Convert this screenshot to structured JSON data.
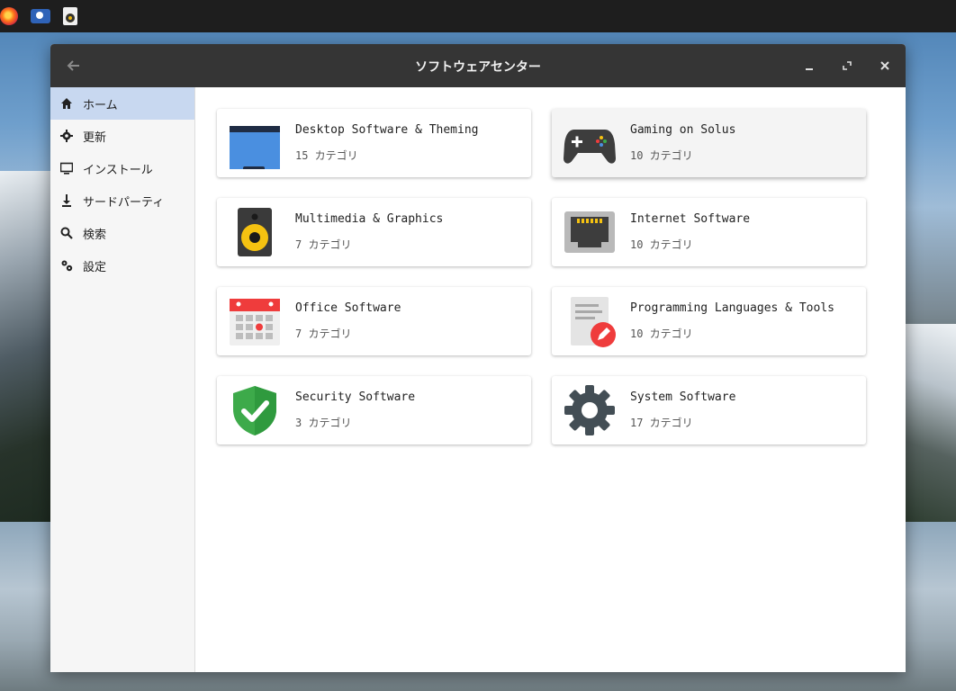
{
  "window": {
    "title": "ソフトウェアセンター"
  },
  "sidebar": {
    "items": [
      {
        "label": "ホーム",
        "icon": "home-icon"
      },
      {
        "label": "更新",
        "icon": "gear-icon"
      },
      {
        "label": "インストール",
        "icon": "monitor-icon"
      },
      {
        "label": "サードパーティ",
        "icon": "download-icon"
      },
      {
        "label": "検索",
        "icon": "search-icon"
      },
      {
        "label": "設定",
        "icon": "settings-icon"
      }
    ]
  },
  "categories": [
    {
      "title": "Desktop Software & Theming",
      "count": "15 カテゴリ",
      "icon": "desktop-folder-icon"
    },
    {
      "title": "Gaming on Solus",
      "count": "10 カテゴリ",
      "icon": "gamepad-icon"
    },
    {
      "title": "Multimedia & Graphics",
      "count": "7 カテゴリ",
      "icon": "speaker-icon"
    },
    {
      "title": "Internet Software",
      "count": "10 カテゴリ",
      "icon": "ethernet-icon"
    },
    {
      "title": "Office Software",
      "count": "7 カテゴリ",
      "icon": "calendar-icon"
    },
    {
      "title": "Programming Languages & Tools",
      "count": "10 カテゴリ",
      "icon": "code-editor-icon"
    },
    {
      "title": "Security Software",
      "count": "3 カテゴリ",
      "icon": "shield-check-icon"
    },
    {
      "title": "System Software",
      "count": "17 カテゴリ",
      "icon": "system-gear-icon"
    }
  ],
  "colors": {
    "titlebar": "#353535",
    "sidebar_active": "#c8d8f0",
    "folder_blue": "#4a8fe0",
    "speaker_yellow": "#f5c211",
    "security_green": "#3daa4a",
    "edit_red": "#ef3c3c"
  }
}
